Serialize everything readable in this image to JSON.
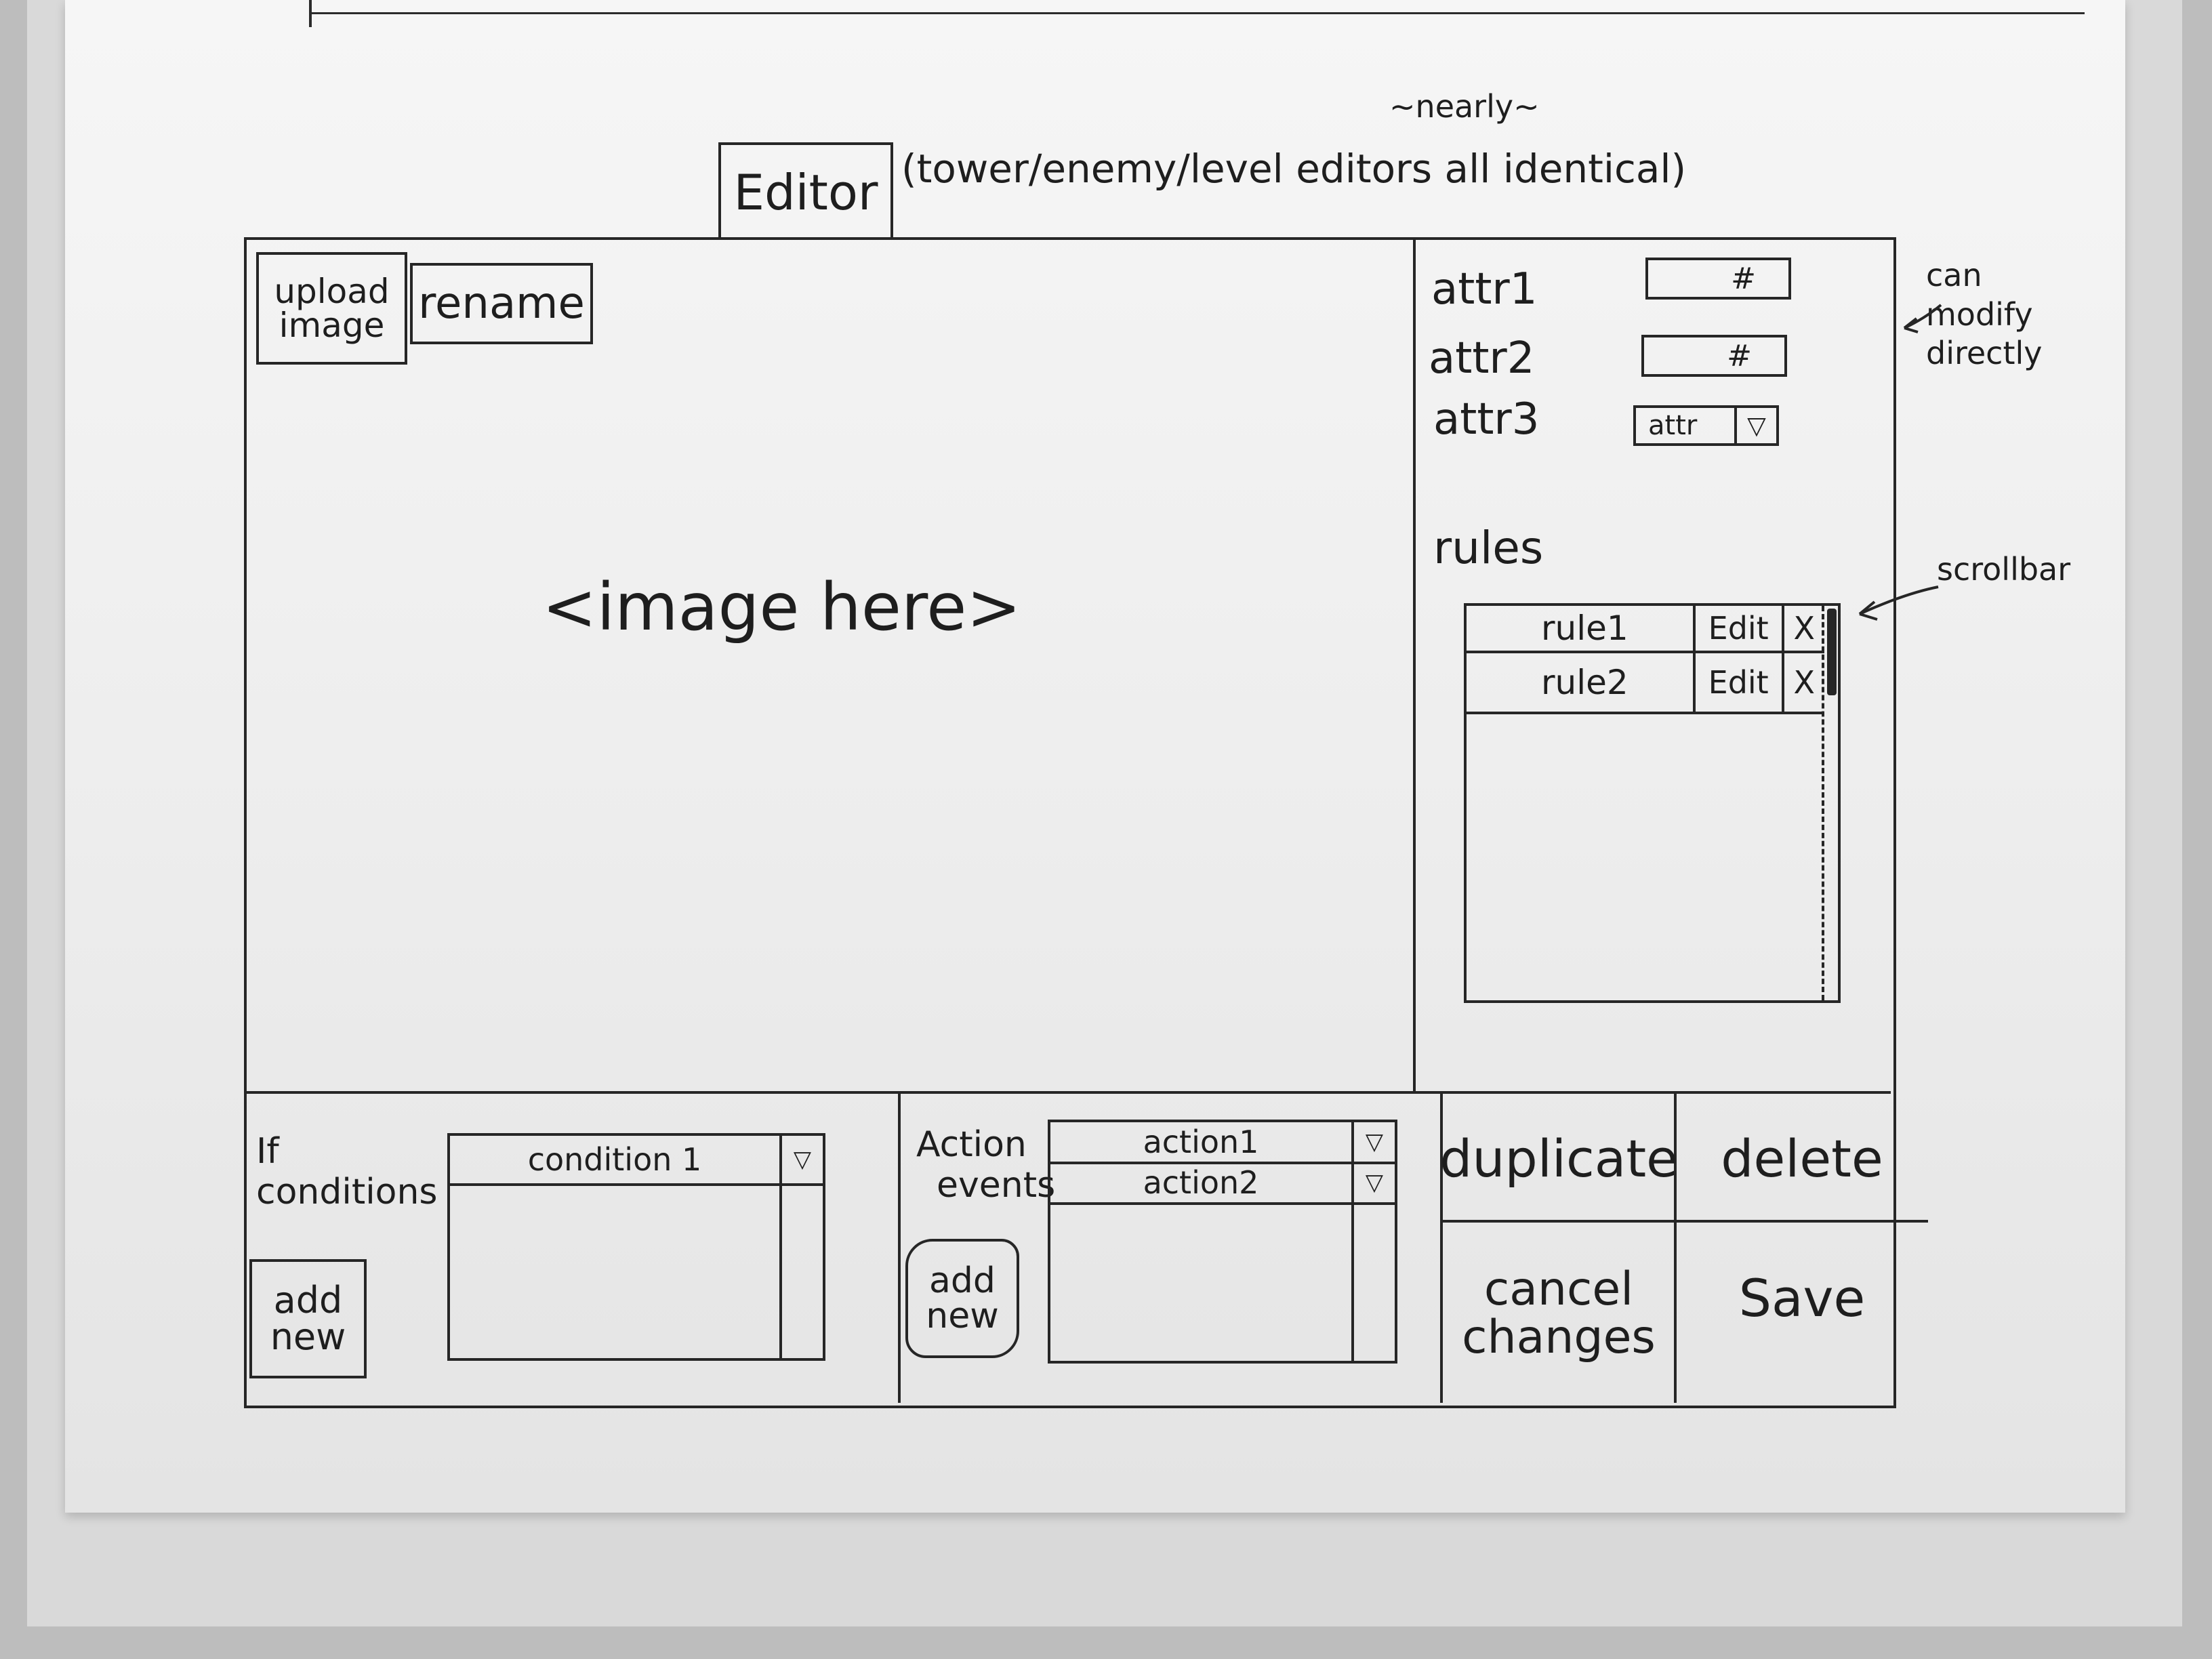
{
  "title": {
    "tab_label": "Editor",
    "note": "(tower/enemy/level editors all identical)",
    "nearly": "~nearly~"
  },
  "image_panel": {
    "upload_label_line1": "upload",
    "upload_label_line2": "image",
    "rename_label": "rename",
    "placeholder": "<image here>"
  },
  "attributes": {
    "items": [
      {
        "label": "attr1",
        "field_value": "#"
      },
      {
        "label": "attr2",
        "field_value": "#"
      },
      {
        "label": "attr3",
        "select_value": "attr"
      }
    ],
    "note_line1": "can",
    "note_line2": "modify",
    "note_line3": "directly"
  },
  "rules": {
    "title": "rules",
    "rows": [
      {
        "name": "rule1",
        "edit_label": "Edit",
        "delete_label": "X"
      },
      {
        "name": "rule2",
        "edit_label": "Edit",
        "delete_label": "X"
      }
    ],
    "scrollbar_note": "scrollbar"
  },
  "conditions": {
    "label_line1": "If",
    "label_line2": "conditions",
    "add_line1": "add",
    "add_line2": "new",
    "rows": [
      {
        "text": "condition 1"
      }
    ]
  },
  "actions": {
    "label_line1": "Action",
    "label_line2": "events",
    "add_line1": "add",
    "add_line2": "new",
    "rows": [
      {
        "text": "action1"
      },
      {
        "text": "action2"
      }
    ]
  },
  "controls": {
    "duplicate": "duplicate",
    "delete": "delete",
    "cancel_line1": "cancel",
    "cancel_line2": "changes",
    "save": "Save"
  },
  "icons": {
    "dropdown_arrow": "▽"
  }
}
